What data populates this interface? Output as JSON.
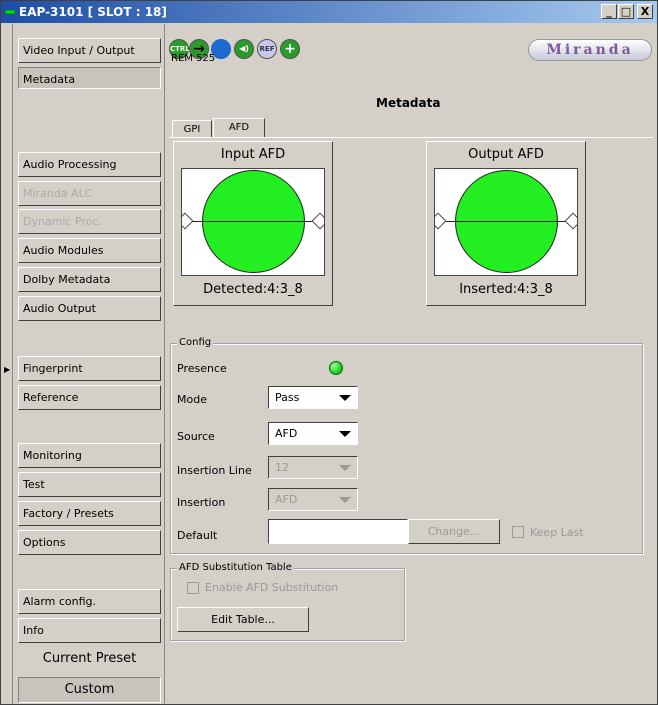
{
  "window": {
    "title": "EAP-3101 [ SLOT : 18]",
    "min": "_",
    "max": "□",
    "close": "X"
  },
  "sidebar": {
    "items": [
      {
        "label": "Video Input / Output"
      },
      {
        "label": "Metadata"
      },
      {
        "label": "Audio Processing"
      },
      {
        "label": "Miranda ALC"
      },
      {
        "label": "Dynamic Proc."
      },
      {
        "label": "Audio Modules"
      },
      {
        "label": "Dolby Metadata"
      },
      {
        "label": "Audio Output"
      },
      {
        "label": "Fingerprint"
      },
      {
        "label": "Reference"
      },
      {
        "label": "Monitoring"
      },
      {
        "label": "Test"
      },
      {
        "label": "Factory / Presets"
      },
      {
        "label": "Options"
      },
      {
        "label": "Alarm config."
      },
      {
        "label": "Info"
      }
    ],
    "current_preset_label": "Current Preset",
    "current_preset_value": "Custom"
  },
  "toolbar": {
    "icons": [
      {
        "name": "ctrl-icon",
        "text": "CTRL"
      },
      {
        "name": "arrow-right-icon",
        "text": "→"
      },
      {
        "name": "arrow-loop-icon",
        "text": ""
      },
      {
        "name": "speaker-icon",
        "text": "◀)"
      },
      {
        "name": "ref-icon",
        "text": "REF"
      },
      {
        "name": "plus-icon",
        "text": "+"
      }
    ],
    "rem_text": "REM 525",
    "logo": "Miranda"
  },
  "main": {
    "title": "Metadata",
    "tabs": [
      {
        "label": "GPI"
      },
      {
        "label": "AFD"
      }
    ],
    "input_afd": {
      "header": "Input AFD",
      "footer": "Detected:4:3_8"
    },
    "output_afd": {
      "header": "Output AFD",
      "footer": "Inserted:4:3_8"
    },
    "config": {
      "legend": "Config",
      "presence_label": "Presence",
      "mode_label": "Mode",
      "mode_value": "Pass",
      "source_label": "Source",
      "source_value": "AFD",
      "insertion_line_label": "Insertion Line",
      "insertion_line_value": "12",
      "insertion_label": "Insertion",
      "insertion_value": "AFD",
      "default_label": "Default",
      "default_value": "",
      "change_button": "Change...",
      "keep_last_label": "Keep Last"
    },
    "substitution": {
      "legend": "AFD Substitution Table",
      "enable_label": "Enable AFD Substitution",
      "edit_button": "Edit Table..."
    }
  },
  "colors": {
    "titlebar_start": "#1d4da5",
    "led_green": "#18d018",
    "afd_green": "#22ee22",
    "logo_purple": "#7a5b9b"
  }
}
